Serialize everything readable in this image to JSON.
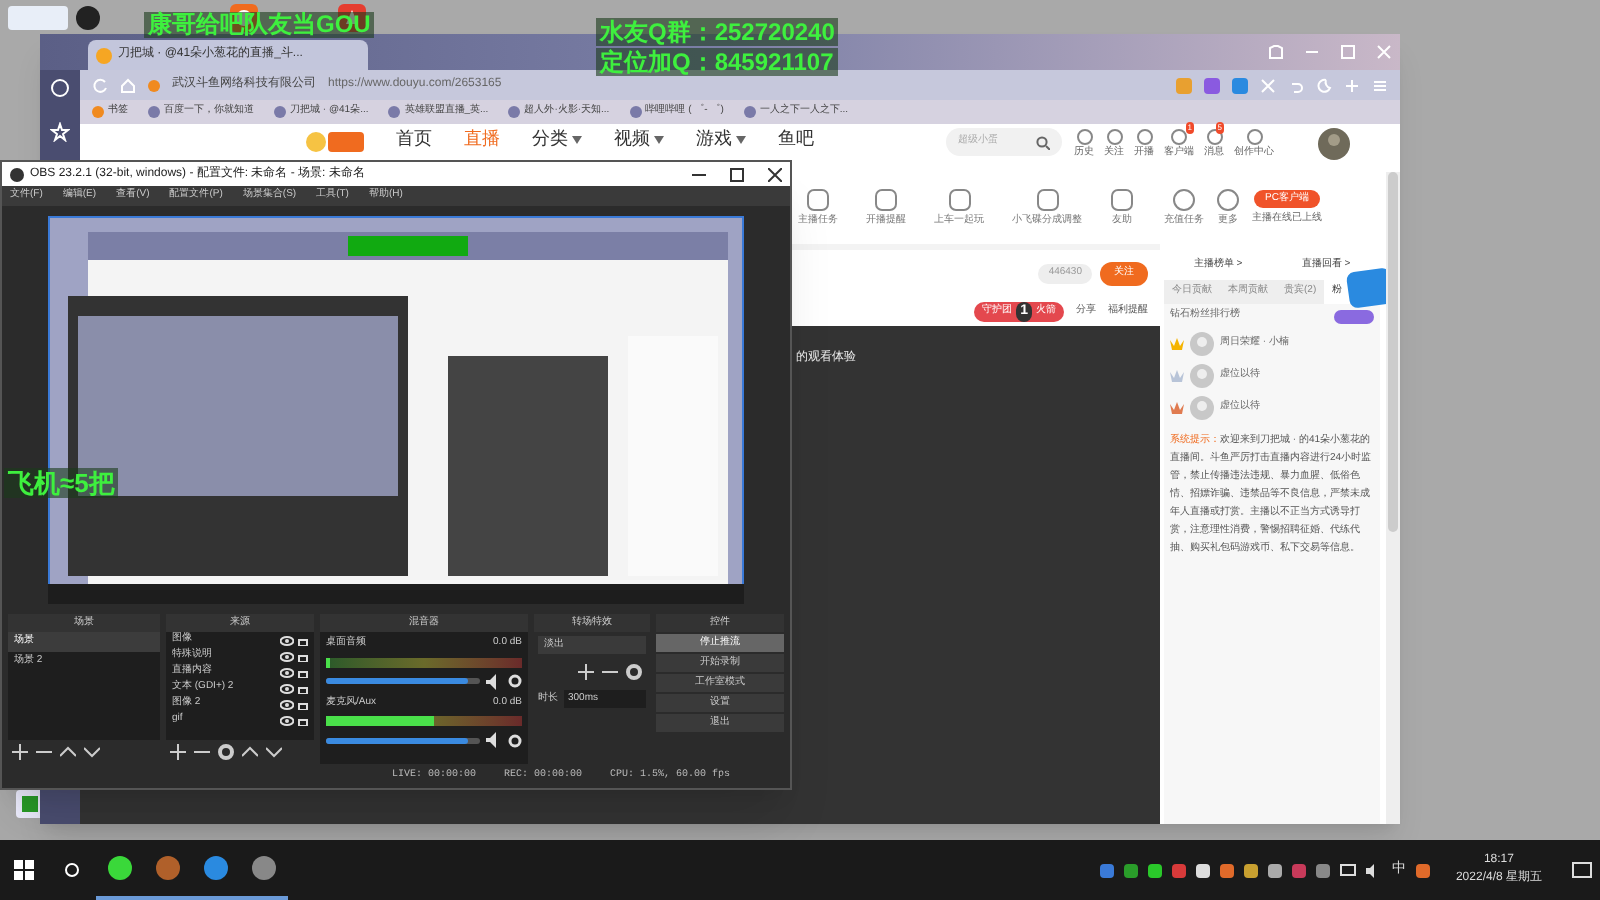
{
  "overlay": {
    "caption": "康哥给吧队友当GOU",
    "qq_group": "水友Q群：252720240",
    "qq_locate": "定位加Q：845921107",
    "side_text": "飞机≈5把"
  },
  "browser": {
    "tab_title": "刀把城 · @41朵小葱花的直播_斗...",
    "site_name": "武汉斗鱼网络科技有限公司",
    "url": "https://www.douyu.com/2653165",
    "bookmarks": [
      "书签",
      "百度一下，你就知道",
      "刀把城 · @41朵...",
      "英雄联盟直播_英...",
      "超人外·火影·天知...",
      "哔哩哔哩 ( ゜- ゜)",
      "一人之下一人之下..."
    ]
  },
  "site": {
    "nav": [
      {
        "label": "首页",
        "selected": false,
        "dropdown": false
      },
      {
        "label": "直播",
        "selected": true,
        "dropdown": false
      },
      {
        "label": "分类",
        "selected": false,
        "dropdown": true
      },
      {
        "label": "视频",
        "selected": false,
        "dropdown": true
      },
      {
        "label": "游戏",
        "selected": false,
        "dropdown": true
      },
      {
        "label": "鱼吧",
        "selected": false,
        "dropdown": false
      }
    ],
    "search_placeholder": "超级小蛋",
    "header_icons": [
      {
        "label": "历史"
      },
      {
        "label": "关注"
      },
      {
        "label": "开播"
      },
      {
        "label": "客户端",
        "badge": "1"
      },
      {
        "label": "消息",
        "badge": "5"
      },
      {
        "label": "创作中心"
      }
    ],
    "toolbar": [
      "主播任务",
      "开播提醒",
      "上车一起玩",
      "小飞碟分成调整",
      "友助",
      "充值任务",
      "更多"
    ],
    "pc_client": "PC客户端",
    "pc_note": "主播在线已上线",
    "follow_count": "446430",
    "follow": "关注",
    "guard": "守护团",
    "guard_level": "1",
    "guard_tail": "火箭",
    "share": "分享",
    "remind": "福利提醒",
    "video_note": "的观看体验"
  },
  "panel": {
    "links": [
      "主播榜单 >",
      "直播回看 >"
    ],
    "tabs": [
      {
        "label": "今日贡献",
        "selected": false
      },
      {
        "label": "本周贡献",
        "selected": false
      },
      {
        "label": "贵宾(2)",
        "selected": false
      },
      {
        "label": "粉",
        "selected": true
      }
    ],
    "board_title": "钻石粉丝排行榜",
    "ranks": [
      {
        "name": "周日荣耀 · 小楠",
        "color": "#f5b400"
      },
      {
        "name": "虚位以待",
        "color": "#b8c4d8"
      },
      {
        "name": "虚位以待",
        "color": "#e07b50"
      }
    ],
    "notice_label": "系统提示：",
    "notice": "欢迎来到刀把城 · 的41朵小葱花的直播间。斗鱼严厉打击直播内容进行24小时监管，禁止传播违法违规、暴力血腥、低俗色情、招嫖诈骗、违禁品等不良信息，严禁未成年人直播或打赏。主播以不正当方式诱导打赏，注意理性消费，警惕招聘征婚、代练代抽、购买礼包码游戏币、私下交易等信息。"
  },
  "obs": {
    "title": "OBS 23.2.1 (32-bit, windows) - 配置文件: 未命名 - 场景: 未命名",
    "menu": [
      "文件(F)",
      "编辑(E)",
      "查看(V)",
      "配置文件(P)",
      "场景集合(S)",
      "工具(T)",
      "帮助(H)"
    ],
    "docks": [
      "场景",
      "来源",
      "混音器",
      "转场特效",
      "控件"
    ],
    "scenes": [
      {
        "name": "场景",
        "selected": true
      },
      {
        "name": "场景 2",
        "selected": false
      }
    ],
    "sources": [
      "图像",
      "特殊说明",
      "直播内容",
      "文本 (GDI+) 2",
      "图像 2",
      "gif"
    ],
    "mixer": [
      {
        "name": "桌面音频",
        "reading": "0.0 dB",
        "meter": {
          "level": 0.02
        },
        "volume": {
          "level": 0.92
        }
      },
      {
        "name": "麦克风/Aux",
        "reading": "0.0 dB",
        "meter": {
          "level": 0.55
        },
        "volume": {
          "level": 0.92
        }
      }
    ],
    "transition": "淡出",
    "duration_label": "时长",
    "duration": "300ms",
    "controls": [
      {
        "label": "停止推流",
        "active": true
      },
      {
        "label": "开始录制",
        "active": false
      },
      {
        "label": "工作室模式",
        "active": false
      },
      {
        "label": "设置",
        "active": false
      },
      {
        "label": "退出",
        "active": false
      }
    ],
    "status": [
      "LIVE: 00:00:00",
      "REC: 00:00:00",
      "CPU: 1.5%, 60.00 fps"
    ]
  },
  "taskbar": {
    "time": "18:17",
    "date": "2022/4/8 星期五",
    "ime": "中"
  }
}
